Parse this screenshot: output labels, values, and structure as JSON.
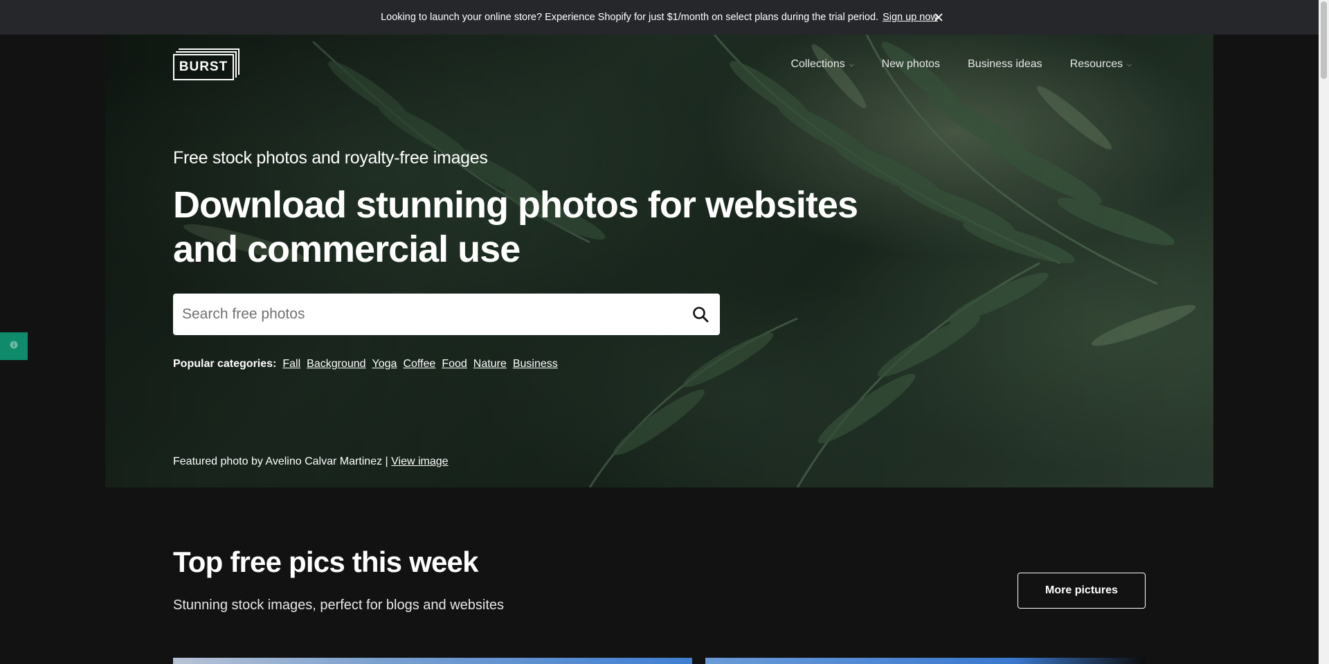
{
  "announcement": {
    "message": "Looking to launch your online store? Experience Shopify for just $1/month on select plans during the trial period.",
    "link_label": "Sign up now",
    "close_icon": "close-icon"
  },
  "logo": {
    "text": "BURST"
  },
  "nav": {
    "items": [
      {
        "label": "Collections",
        "has_dropdown": true
      },
      {
        "label": "New photos",
        "has_dropdown": false
      },
      {
        "label": "Business ideas",
        "has_dropdown": false
      },
      {
        "label": "Resources",
        "has_dropdown": true
      }
    ]
  },
  "hero": {
    "kicker": "Free stock photos and royalty-free images",
    "headline": "Download stunning photos for websites and commercial use",
    "search": {
      "placeholder": "Search free photos",
      "value": "",
      "icon": "search-icon"
    },
    "popular_label": "Popular categories:",
    "categories": [
      "Fall",
      "Background",
      "Yoga",
      "Coffee",
      "Food",
      "Nature",
      "Business"
    ],
    "featured_text": "Featured photo by Avelino Calvar Martinez |",
    "featured_link": "View image"
  },
  "section": {
    "title": "Top free pics this week",
    "subtitle": "Stunning stock images, perfect for blogs and websites",
    "more_button": "More pictures"
  },
  "colors": {
    "page_bg": "#121212",
    "announcement_bg": "#25272b",
    "feedback_tab": "#0f8a6a"
  }
}
